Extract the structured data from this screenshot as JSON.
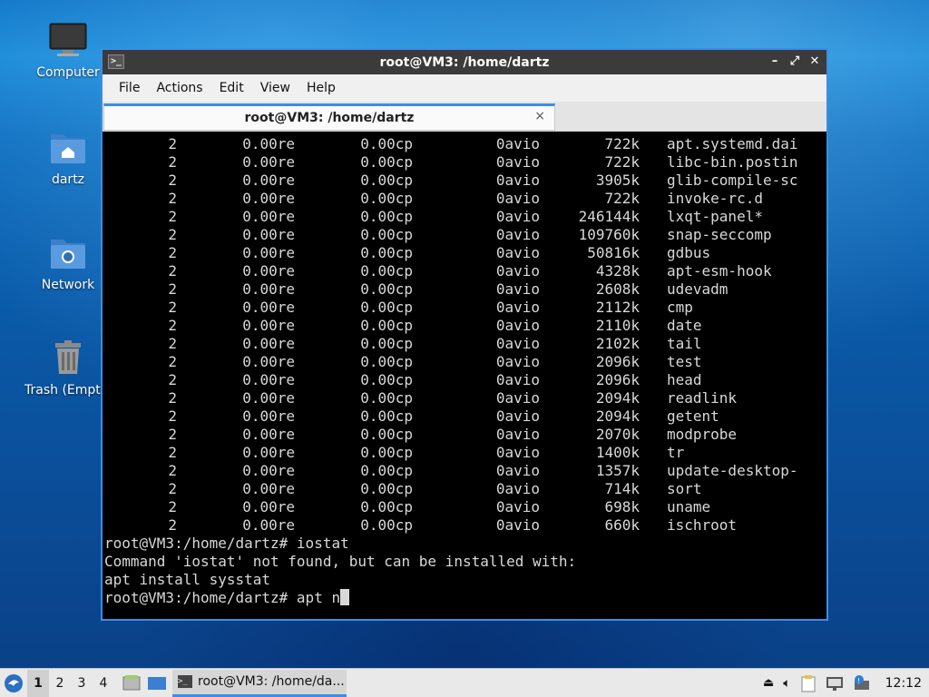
{
  "desktop": {
    "icons": [
      {
        "label": "Computer",
        "icon": "monitor-icon"
      },
      {
        "label": "dartz",
        "icon": "home-folder-icon"
      },
      {
        "label": "Network",
        "icon": "network-folder-icon"
      },
      {
        "label": "Trash (Empty)",
        "icon": "trash-icon"
      }
    ]
  },
  "window": {
    "title": "root@VM3: /home/dartz",
    "menu": [
      "File",
      "Actions",
      "Edit",
      "View",
      "Help"
    ],
    "tab_label": "root@VM3: /home/dartz",
    "tab_close": "×",
    "buttons": {
      "minimize": "–",
      "maximize": "⤢",
      "close": "✕"
    }
  },
  "terminal": {
    "rows": [
      [
        "2",
        "0.00re",
        "0.00cp",
        "0avio",
        "722k",
        "apt.systemd.dai"
      ],
      [
        "2",
        "0.00re",
        "0.00cp",
        "0avio",
        "722k",
        "libc-bin.postin"
      ],
      [
        "2",
        "0.00re",
        "0.00cp",
        "0avio",
        "3905k",
        "glib-compile-sc"
      ],
      [
        "2",
        "0.00re",
        "0.00cp",
        "0avio",
        "722k",
        "invoke-rc.d"
      ],
      [
        "2",
        "0.00re",
        "0.00cp",
        "0avio",
        "246144k",
        "lxqt-panel*"
      ],
      [
        "2",
        "0.00re",
        "0.00cp",
        "0avio",
        "109760k",
        "snap-seccomp"
      ],
      [
        "2",
        "0.00re",
        "0.00cp",
        "0avio",
        "50816k",
        "gdbus"
      ],
      [
        "2",
        "0.00re",
        "0.00cp",
        "0avio",
        "4328k",
        "apt-esm-hook"
      ],
      [
        "2",
        "0.00re",
        "0.00cp",
        "0avio",
        "2608k",
        "udevadm"
      ],
      [
        "2",
        "0.00re",
        "0.00cp",
        "0avio",
        "2112k",
        "cmp"
      ],
      [
        "2",
        "0.00re",
        "0.00cp",
        "0avio",
        "2110k",
        "date"
      ],
      [
        "2",
        "0.00re",
        "0.00cp",
        "0avio",
        "2102k",
        "tail"
      ],
      [
        "2",
        "0.00re",
        "0.00cp",
        "0avio",
        "2096k",
        "test"
      ],
      [
        "2",
        "0.00re",
        "0.00cp",
        "0avio",
        "2096k",
        "head"
      ],
      [
        "2",
        "0.00re",
        "0.00cp",
        "0avio",
        "2094k",
        "readlink"
      ],
      [
        "2",
        "0.00re",
        "0.00cp",
        "0avio",
        "2094k",
        "getent"
      ],
      [
        "2",
        "0.00re",
        "0.00cp",
        "0avio",
        "2070k",
        "modprobe"
      ],
      [
        "2",
        "0.00re",
        "0.00cp",
        "0avio",
        "1400k",
        "tr"
      ],
      [
        "2",
        "0.00re",
        "0.00cp",
        "0avio",
        "1357k",
        "update-desktop-"
      ],
      [
        "2",
        "0.00re",
        "0.00cp",
        "0avio",
        "714k",
        "sort"
      ],
      [
        "2",
        "0.00re",
        "0.00cp",
        "0avio",
        "698k",
        "uname"
      ],
      [
        "2",
        "0.00re",
        "0.00cp",
        "0avio",
        "660k",
        "ischroot"
      ]
    ],
    "lines": [
      "root@VM3:/home/dartz# iostat",
      "Command 'iostat' not found, but can be installed with:",
      "apt install sysstat"
    ],
    "prompt": "root@VM3:/home/dartz# apt n"
  },
  "taskbar": {
    "workspaces": [
      "1",
      "2",
      "3",
      "4"
    ],
    "active_workspace": "1",
    "task_label": "root@VM3: /home/da...",
    "clock": "12:12"
  },
  "colors": {
    "accent": "#3a8ee6",
    "titlebar": "#3b3b3b",
    "terminal_bg": "#000000",
    "terminal_fg": "#d8d8d8"
  }
}
